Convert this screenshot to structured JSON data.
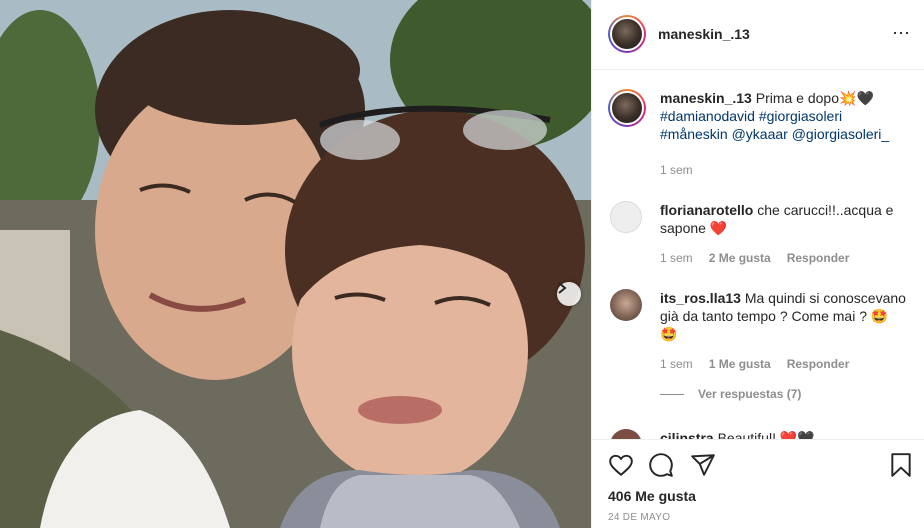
{
  "post": {
    "author": "maneskin_.13",
    "more_icon": "⋯",
    "next_icon": "chevron-right-icon"
  },
  "caption": {
    "author": "maneskin_.13",
    "text": "Prima e dopo",
    "emoji": "💥🖤",
    "tags_line1": "#damianodavid #giorgiasoleri",
    "tags_line2": "#måneskin @ykaaar @giorgiasoleri_",
    "time": "1 sem"
  },
  "comments": [
    {
      "author": "florianarotello",
      "text": "che carucci!!..acqua e sapone",
      "emoji": "❤️",
      "time": "1 sem",
      "likes": "2 Me gusta",
      "reply": "Responder"
    },
    {
      "author": "its_ros.lla13",
      "text": "Ma quindi si conoscevano già da tanto tempo ? Come mai ?",
      "emoji": "🤩",
      "emoji2": "🤩",
      "time": "1 sem",
      "likes": "1 Me gusta",
      "reply": "Responder"
    },
    {
      "author": "cilinstra",
      "text": "Beautiful!",
      "emoji": "❤️🖤"
    }
  ],
  "view_replies": "Ver respuestas (7)",
  "footer": {
    "likes": "406 Me gusta",
    "date": "24 DE MAYO"
  },
  "colors": {
    "hashtag": "#00376b",
    "muted": "#8e8e8e",
    "text": "#262626"
  }
}
